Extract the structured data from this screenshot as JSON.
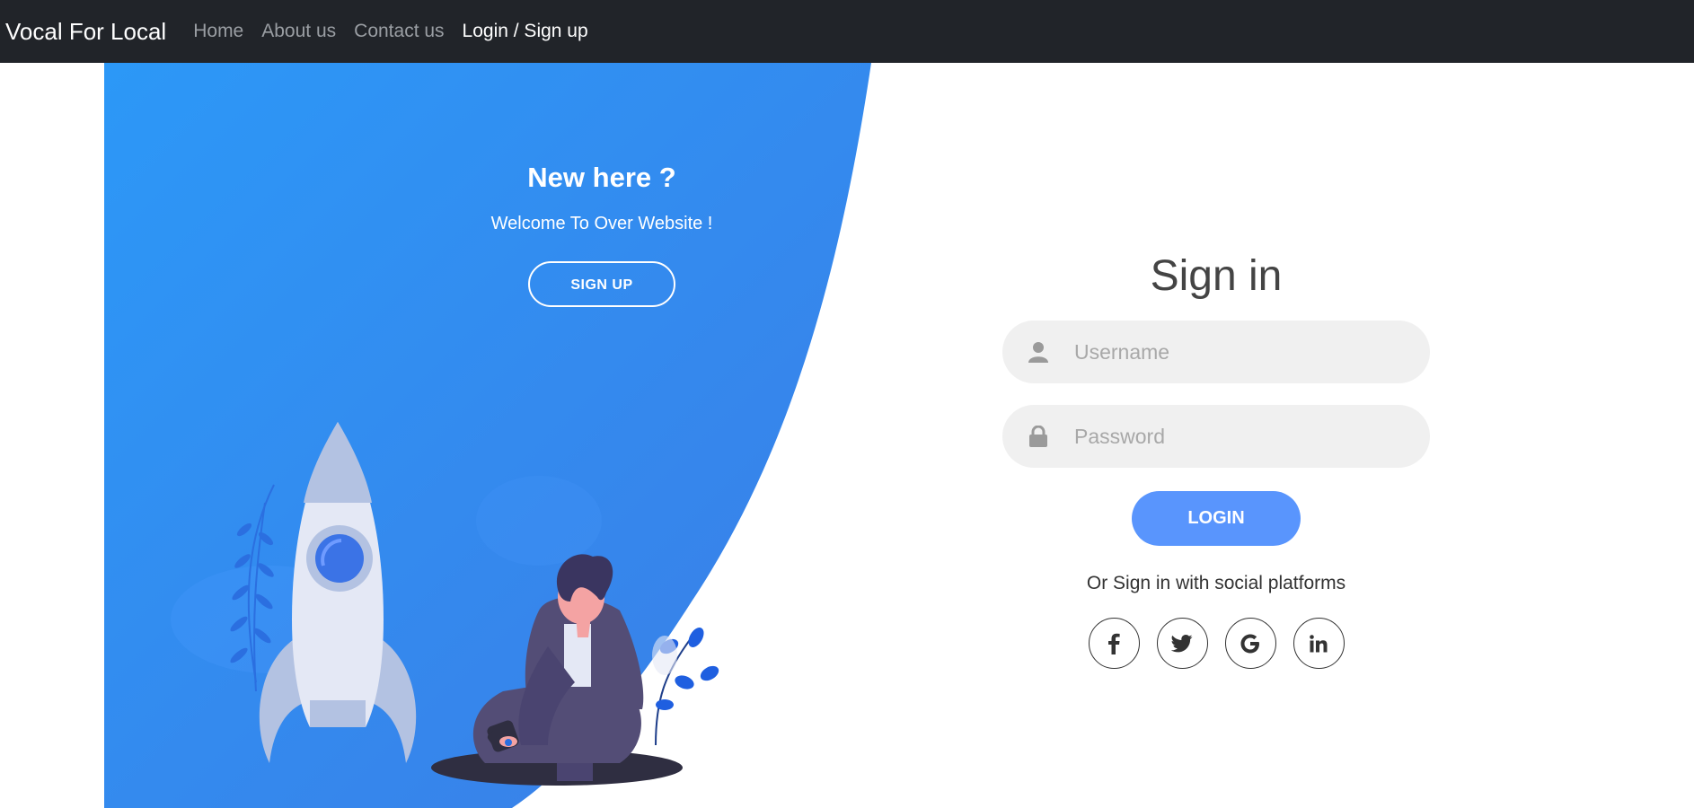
{
  "navbar": {
    "brand": "Vocal For Local",
    "links": [
      "Home",
      "About us",
      "Contact us",
      "Login / Sign up"
    ]
  },
  "panel": {
    "title": "New here ?",
    "subtitle": "Welcome To Over Website !",
    "signup_label": "SIGN UP"
  },
  "form": {
    "title": "Sign in",
    "username_placeholder": "Username",
    "password_placeholder": "Password",
    "login_label": "LOGIN",
    "social_text": "Or Sign in with social platforms",
    "social": [
      "f",
      "t",
      "G",
      "in"
    ]
  },
  "colors": {
    "accent": "#5995fd",
    "panel_gradient_start": "#2c98f7",
    "panel_gradient_end": "#3b7de6",
    "navbar": "#212429"
  },
  "icons": {
    "username": "user-icon",
    "password": "lock-icon",
    "social": [
      "facebook-icon",
      "twitter-icon",
      "google-icon",
      "linkedin-icon"
    ]
  }
}
